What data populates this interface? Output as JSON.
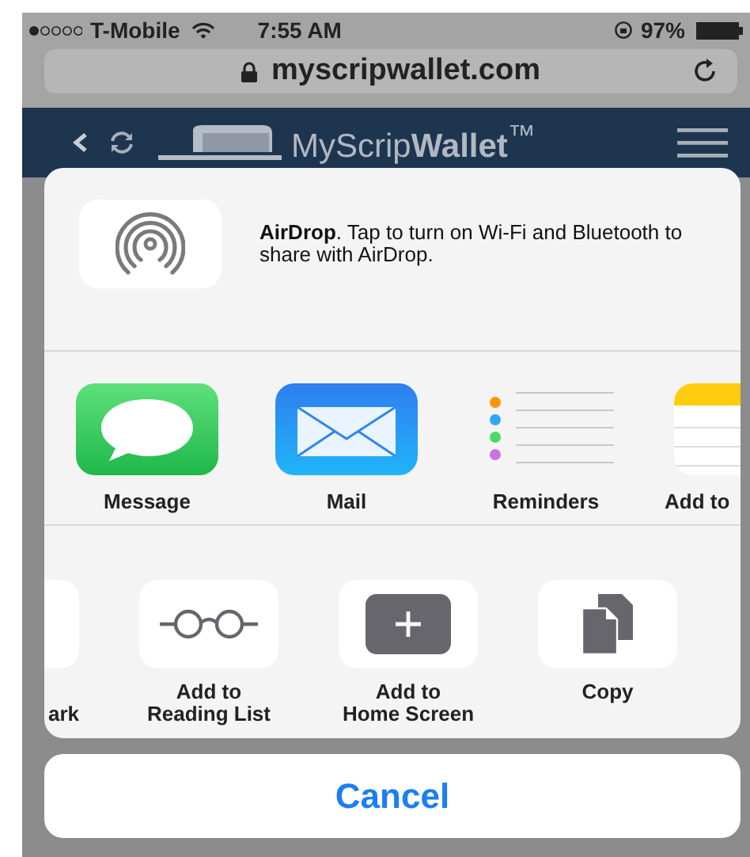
{
  "status_bar": {
    "carrier": "T-Mobile",
    "time": "7:55 AM",
    "battery": "97%"
  },
  "address_bar": {
    "url": "myscripwallet.com"
  },
  "site_header": {
    "logo": "MyScrip**Wallet**$^{™}$"
  },
  "share_sheet": {
    "airdrop": {
      "message": "**AirDrop**. Tap to turn on Wi-Fi and Bluetooth to share with AirDrop."
    },
    "apps": [
      {
        "kind": "message",
        "label": "Message"
      },
      {
        "kind": "mail",
        "label": "Mail"
      },
      {
        "kind": "reminders",
        "label": "Reminders"
      },
      {
        "kind": "notes",
        "label": "Add to"
      }
    ],
    "actions": [
      {
        "kind": "bookmark",
        "label": "ark"
      },
      {
        "kind": "reading-list",
        "label": "Add to\nReading List"
      },
      {
        "kind": "home-screen",
        "label": "Add to\nHome Screen"
      },
      {
        "kind": "copy",
        "label": "Copy"
      }
    ]
  },
  "cancel_button": "Cancel"
}
